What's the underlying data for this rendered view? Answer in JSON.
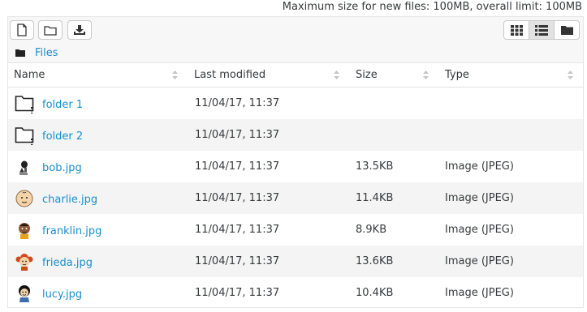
{
  "limits_text": "Maximum size for new files: 100MB, overall limit: 100MB",
  "toolbar": {
    "add_file_icon": "file-icon",
    "create_folder_icon": "folder-icon",
    "download_icon": "download-icon",
    "view_modes": [
      "grid-icon",
      "list-icon",
      "folder-icon"
    ],
    "active_view": "list"
  },
  "path": {
    "label": "Files"
  },
  "columns": {
    "name": "Name",
    "modified": "Last modified",
    "size": "Size",
    "type": "Type"
  },
  "rows": [
    {
      "name": "folder 1",
      "modified": "11/04/17, 11:37",
      "size": "",
      "type": "",
      "icon": "folder"
    },
    {
      "name": "folder 2",
      "modified": "11/04/17, 11:37",
      "size": "",
      "type": "",
      "icon": "folder"
    },
    {
      "name": "bob.jpg",
      "modified": "11/04/17, 11:37",
      "size": "13.5KB",
      "type": "Image (JPEG)",
      "icon": "image-thumbnail"
    },
    {
      "name": "charlie.jpg",
      "modified": "11/04/17, 11:37",
      "size": "11.4KB",
      "type": "Image (JPEG)",
      "icon": "image-thumbnail"
    },
    {
      "name": "franklin.jpg",
      "modified": "11/04/17, 11:37",
      "size": "8.9KB",
      "type": "Image (JPEG)",
      "icon": "image-thumbnail"
    },
    {
      "name": "frieda.jpg",
      "modified": "11/04/17, 11:37",
      "size": "13.6KB",
      "type": "Image (JPEG)",
      "icon": "image-thumbnail"
    },
    {
      "name": "lucy.jpg",
      "modified": "11/04/17, 11:37",
      "size": "10.4KB",
      "type": "Image (JPEG)",
      "icon": "image-thumbnail"
    }
  ],
  "colors": {
    "link": "#1a8fcc",
    "stripe": "#f4f4f4",
    "text": "#373a3c"
  }
}
